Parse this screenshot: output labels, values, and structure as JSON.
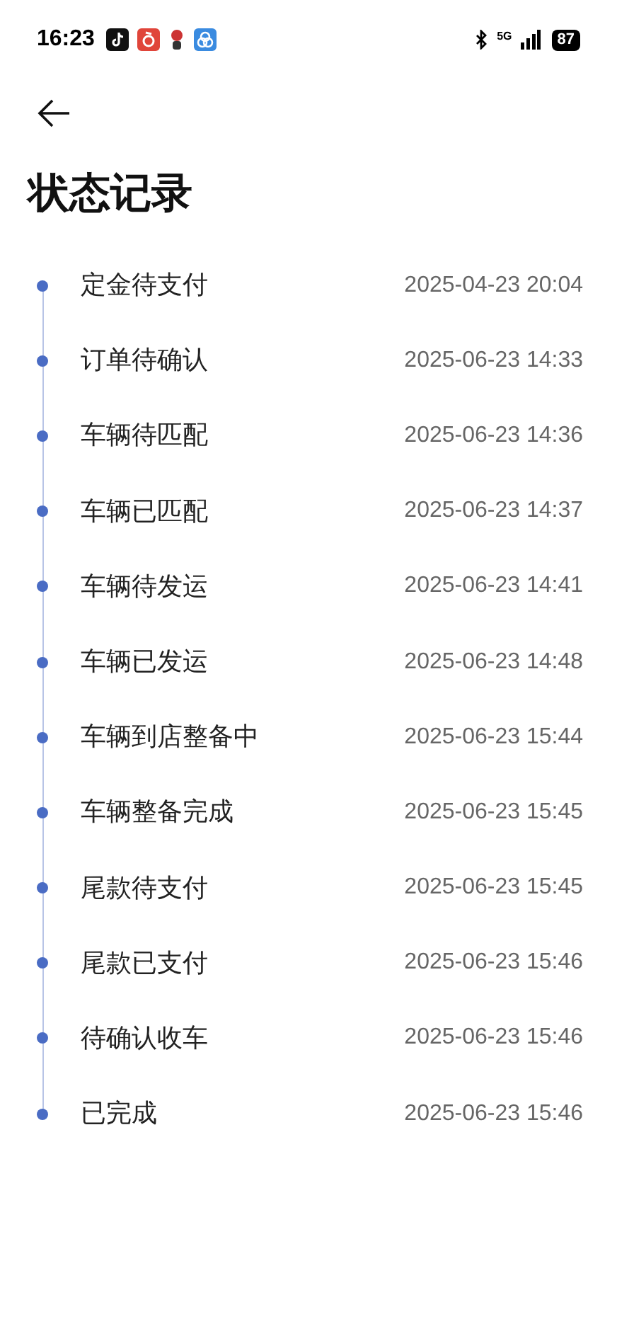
{
  "status_bar": {
    "time": "16:23",
    "network": "5G",
    "battery": "87"
  },
  "title": "状态记录",
  "records": [
    {
      "status": "定金待支付",
      "time": "2025-04-23 20:04"
    },
    {
      "status": "订单待确认",
      "time": "2025-06-23 14:33"
    },
    {
      "status": "车辆待匹配",
      "time": "2025-06-23 14:36"
    },
    {
      "status": "车辆已匹配",
      "time": "2025-06-23 14:37"
    },
    {
      "status": "车辆待发运",
      "time": "2025-06-23 14:41"
    },
    {
      "status": "车辆已发运",
      "time": "2025-06-23 14:48"
    },
    {
      "status": "车辆到店整备中",
      "time": "2025-06-23 15:44"
    },
    {
      "status": "车辆整备完成",
      "time": "2025-06-23 15:45"
    },
    {
      "status": "尾款待支付",
      "time": "2025-06-23 15:45"
    },
    {
      "status": "尾款已支付",
      "time": "2025-06-23 15:46"
    },
    {
      "status": "待确认收车",
      "time": "2025-06-23 15:46"
    },
    {
      "status": "已完成",
      "time": "2025-06-23 15:46"
    }
  ]
}
